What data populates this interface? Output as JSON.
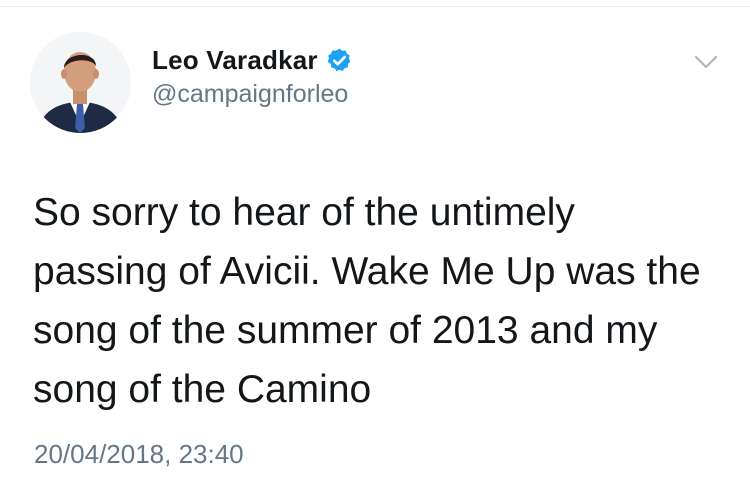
{
  "tweet": {
    "author": {
      "display_name": "Leo Varadkar",
      "handle": "@campaignforleo",
      "verified": true,
      "avatar_icon": "profile-photo"
    },
    "menu_icon": "chevron-down-icon",
    "text_lines": [
      "So sorry to hear of the untimely",
      "passing of Avicii. Wake Me Up was the",
      "song of the summer of 2013 and my",
      "song of the Camino"
    ],
    "timestamp": "20/04/2018, 23:40"
  },
  "colors": {
    "text_primary": "#14171a",
    "text_secondary": "#657786",
    "verified_blue": "#1da1f2",
    "divider": "#e6ecf0"
  }
}
